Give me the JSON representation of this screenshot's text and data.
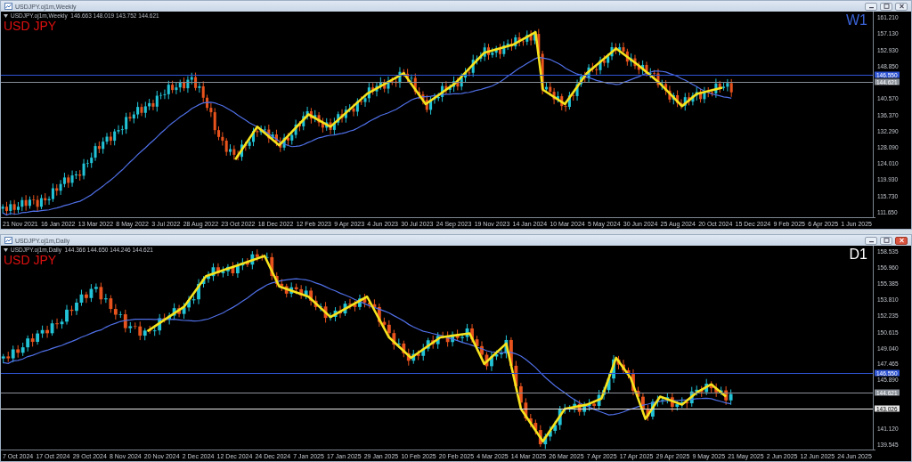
{
  "windows": [
    {
      "title": "USDJPY.oj1m,Weekly",
      "info": "USDJPY.oj1m,Weekly  146.663 148.019 143.752 144.621",
      "symbol": "USD JPY",
      "timeframe": "W1",
      "color": "#3a62d6",
      "close_active": false,
      "price_ticks": [
        "161.210",
        "157.130",
        "152.930",
        "148.850",
        "140.570",
        "136.370",
        "132.290",
        "128.090",
        "124.010",
        "119.930",
        "115.730",
        "111.650"
      ],
      "price_tags": [
        {
          "text": "146.550",
          "color": "#2f55d4"
        },
        {
          "text": "144.621",
          "color": "#8a9098"
        }
      ],
      "date_labels": [
        "21 Nov 2021",
        "16 Jan 2022",
        "13 Mar 2022",
        "8 May 2022",
        "3 Jul 2022",
        "28 Aug 2022",
        "23 Oct 2022",
        "18 Dec 2022",
        "12 Feb 2023",
        "9 Apr 2023",
        "4 Jun 2023",
        "30 Jul 2023",
        "24 Sep 2023",
        "19 Nov 2023",
        "14 Jan 2024",
        "10 Mar 2024",
        "5 May 2024",
        "30 Jun 2024",
        "25 Aug 2024",
        "20 Oct 2024",
        "15 Dec 2024",
        "9 Feb 2025",
        "6 Apr 2025",
        "1 Jun 2025"
      ]
    },
    {
      "title": "USDJPY.oj1m,Daily",
      "info": "USDJPY.oj1m,Daily  144.366 144.650 144.246 144.621",
      "symbol": "USD JPY",
      "timeframe": "D1",
      "color": "#ffffff",
      "close_active": true,
      "price_ticks": [
        "158.535",
        "156.960",
        "155.385",
        "153.810",
        "152.235",
        "150.615",
        "149.040",
        "147.465",
        "145.890",
        "141.120",
        "139.545"
      ],
      "price_tags": [
        {
          "text": "146.550",
          "color": "#2f55d4"
        },
        {
          "text": "144.621",
          "color": "#8a9098"
        },
        {
          "text": "143.026",
          "color": "#e8e8e8"
        }
      ],
      "date_labels": [
        "7 Oct 2024",
        "17 Oct 2024",
        "29 Oct 2024",
        "8 Nov 2024",
        "20 Nov 2024",
        "2 Dec 2024",
        "12 Dec 2024",
        "24 Dec 2024",
        "7 Jan 2025",
        "17 Jan 2025",
        "29 Jan 2025",
        "10 Feb 2025",
        "20 Feb 2025",
        "4 Mar 2025",
        "14 Mar 2025",
        "26 Mar 2025",
        "7 Apr 2025",
        "17 Apr 2025",
        "29 Apr 2025",
        "9 May 2025",
        "21 May 2025",
        "2 Jun 2025",
        "12 Jun 2025",
        "24 Jun 2025"
      ]
    }
  ]
}
